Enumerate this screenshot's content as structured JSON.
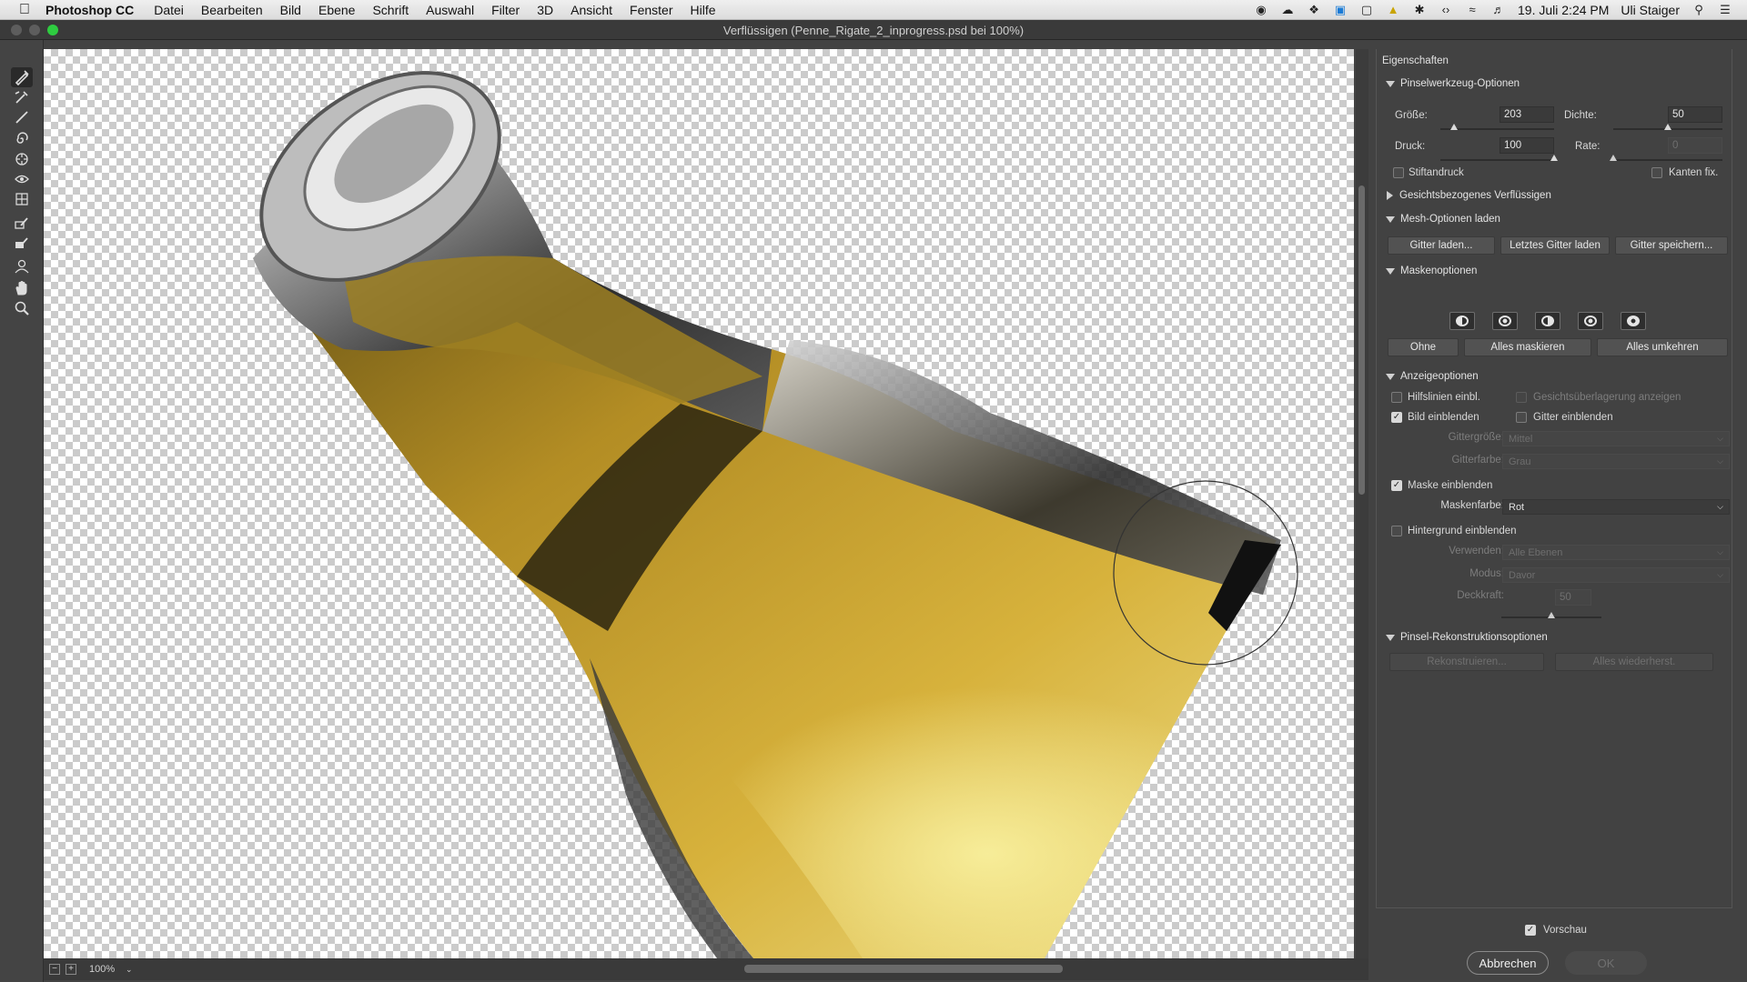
{
  "menubar": {
    "app_name": "Photoshop CC",
    "items": [
      "Datei",
      "Bearbeiten",
      "Bild",
      "Ebene",
      "Schrift",
      "Auswahl",
      "Filter",
      "3D",
      "Ansicht",
      "Fenster",
      "Hilfe"
    ],
    "clock": "19. Juli  2:24 PM",
    "user": "Uli Staiger",
    "status_icons": [
      "record-icon",
      "creative-cloud-icon",
      "dropbox-icon",
      "skype-icon",
      "display-icon",
      "warning-icon",
      "bluetooth-icon",
      "code-icon",
      "wifi-icon",
      "volume-icon"
    ]
  },
  "window": {
    "title": "Verflüssigen (Penne_Rigate_2_inprogress.psd bei 100%)"
  },
  "tools": [
    "forward-warp-icon",
    "reconstruct-icon",
    "smooth-icon",
    "twirl-icon",
    "pucker-icon",
    "bloat-icon",
    "push-left-icon",
    "freeze-mask-icon",
    "thaw-mask-icon",
    "face-tool-icon",
    "hand-icon",
    "zoom-icon"
  ],
  "status": {
    "zoom": "100%"
  },
  "panel": {
    "title": "Eigenschaften",
    "brush": {
      "section": "Pinselwerkzeug-Optionen",
      "size_label": "Größe:",
      "size_value": "203",
      "size_pos": 0.12,
      "density_label": "Dichte:",
      "density_value": "50",
      "density_pos": 0.5,
      "pressure_label": "Druck:",
      "pressure_value": "100",
      "pressure_pos": 1.0,
      "rate_label": "Rate:",
      "rate_value": "0",
      "rate_pos": 0.0,
      "stylus_label": "Stiftandruck",
      "pin_edges_label": "Kanten fix."
    },
    "face_section": "Gesichtsbezogenes Verflüssigen",
    "mesh": {
      "section": "Mesh-Optionen laden",
      "load": "Gitter laden...",
      "load_last": "Letztes Gitter laden",
      "save": "Gitter speichern..."
    },
    "mask": {
      "section": "Maskenoptionen",
      "none": "Ohne",
      "mask_all": "Alles maskieren",
      "invert_all": "Alles umkehren"
    },
    "view": {
      "section": "Anzeigeoptionen",
      "guides": "Hilfslinien einbl.",
      "face_overlay": "Gesichtsüberlagerung anzeigen",
      "show_image": "Bild einblenden",
      "show_mesh": "Gitter einblenden",
      "mesh_size_label": "Gittergröße:",
      "mesh_size_value": "Mittel",
      "mesh_color_label": "Gitterfarbe:",
      "mesh_color_value": "Grau",
      "show_mask": "Maske einblenden",
      "mask_color_label": "Maskenfarbe:",
      "mask_color_value": "Rot",
      "show_backdrop": "Hintergrund einblenden",
      "use_label": "Verwenden:",
      "use_value": "Alle Ebenen",
      "mode_label": "Modus:",
      "mode_value": "Davor",
      "opacity_label": "Deckkraft:",
      "opacity_value": "50",
      "opacity_pos": 0.5
    },
    "reconstruct": {
      "section": "Pinsel-Rekonstruktionsoptionen",
      "reconstruct": "Rekonstruieren...",
      "restore_all": "Alles wiederherst."
    },
    "preview_label": "Vorschau",
    "cancel": "Abbrechen",
    "ok": "OK"
  },
  "colors": {
    "panel_bg": "#424242",
    "liquid_yellow": "#c9a02a",
    "mask_on": "#d9d9d9"
  }
}
